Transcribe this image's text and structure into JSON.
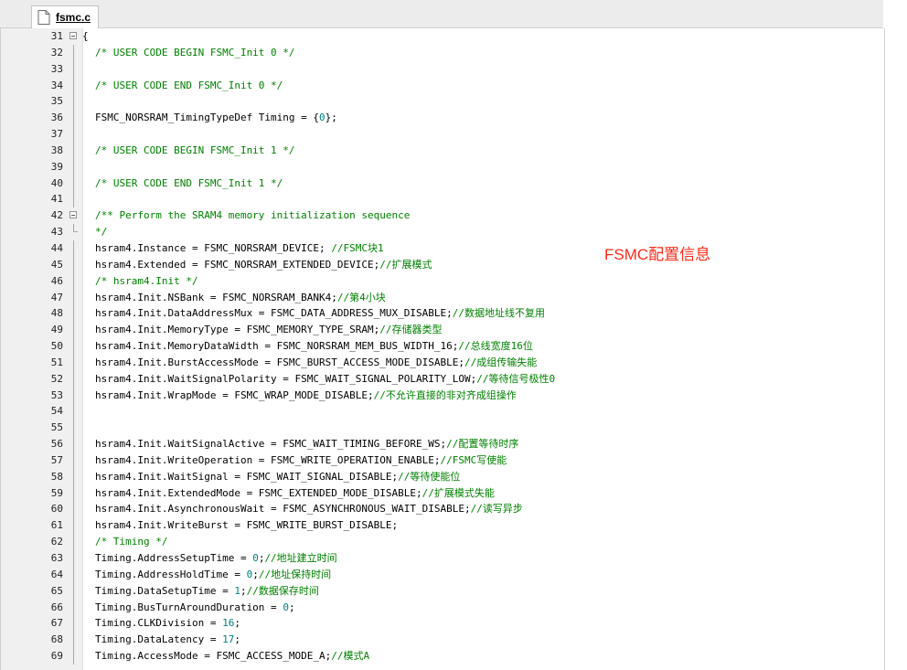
{
  "tab": {
    "label": "fsmc.c",
    "icon": "file-icon"
  },
  "annotation": "FSMC配置信息",
  "colors": {
    "comment": "#008000",
    "number": "#008080",
    "annotation": "#ff2a1a"
  },
  "code_lines": [
    {
      "n": "31",
      "fold": "open",
      "parts": [
        [
          "{",
          ""
        ]
      ]
    },
    {
      "n": "32",
      "fold": "line",
      "parts": [
        [
          "/* USER CODE BEGIN FSMC_Init 0 */",
          "cm"
        ]
      ]
    },
    {
      "n": "33",
      "fold": "line",
      "parts": []
    },
    {
      "n": "34",
      "fold": "line",
      "parts": [
        [
          "/* USER CODE END FSMC_Init 0 */",
          "cm"
        ]
      ]
    },
    {
      "n": "35",
      "fold": "line",
      "parts": []
    },
    {
      "n": "36",
      "fold": "line",
      "parts": [
        [
          "FSMC_NORSRAM_TimingTypeDef Timing = {",
          ""
        ],
        [
          "0",
          "num"
        ],
        [
          "};",
          ""
        ]
      ]
    },
    {
      "n": "37",
      "fold": "line",
      "parts": []
    },
    {
      "n": "38",
      "fold": "line",
      "parts": [
        [
          "/* USER CODE BEGIN FSMC_Init 1 */",
          "cm"
        ]
      ]
    },
    {
      "n": "39",
      "fold": "line",
      "parts": []
    },
    {
      "n": "40",
      "fold": "line",
      "parts": [
        [
          "/* USER CODE END FSMC_Init 1 */",
          "cm"
        ]
      ]
    },
    {
      "n": "41",
      "fold": "line",
      "parts": []
    },
    {
      "n": "42",
      "fold": "open",
      "parts": [
        [
          "/** Perform the SRAM4 memory initialization sequence",
          "cm"
        ]
      ]
    },
    {
      "n": "43",
      "fold": "end",
      "parts": [
        [
          "*/",
          "cm"
        ]
      ]
    },
    {
      "n": "44",
      "fold": "line",
      "parts": [
        [
          "hsram4.Instance = FSMC_NORSRAM_DEVICE; ",
          ""
        ],
        [
          "//FSMC块1",
          "cm"
        ]
      ]
    },
    {
      "n": "45",
      "fold": "line",
      "parts": [
        [
          "hsram4.Extended = FSMC_NORSRAM_EXTENDED_DEVICE;",
          ""
        ],
        [
          "//扩展模式",
          "cm"
        ]
      ]
    },
    {
      "n": "46",
      "fold": "line",
      "parts": [
        [
          "/* hsram4.Init */",
          "cm"
        ]
      ]
    },
    {
      "n": "47",
      "fold": "line",
      "parts": [
        [
          "hsram4.Init.NSBank = FSMC_NORSRAM_BANK4;",
          ""
        ],
        [
          "//第4小块",
          "cm"
        ]
      ]
    },
    {
      "n": "48",
      "fold": "line",
      "parts": [
        [
          "hsram4.Init.DataAddressMux = FSMC_DATA_ADDRESS_MUX_DISABLE;",
          ""
        ],
        [
          "//数据地址线不复用",
          "cm"
        ]
      ]
    },
    {
      "n": "49",
      "fold": "line",
      "parts": [
        [
          "hsram4.Init.MemoryType = FSMC_MEMORY_TYPE_SRAM;",
          ""
        ],
        [
          "//存储器类型",
          "cm"
        ]
      ]
    },
    {
      "n": "50",
      "fold": "line",
      "parts": [
        [
          "hsram4.Init.MemoryDataWidth = FSMC_NORSRAM_MEM_BUS_WIDTH_16;",
          ""
        ],
        [
          "//总线宽度16位",
          "cm"
        ]
      ]
    },
    {
      "n": "51",
      "fold": "line",
      "parts": [
        [
          "hsram4.Init.BurstAccessMode = FSMC_BURST_ACCESS_MODE_DISABLE;",
          ""
        ],
        [
          "//成组传输失能",
          "cm"
        ]
      ]
    },
    {
      "n": "52",
      "fold": "line",
      "parts": [
        [
          "hsram4.Init.WaitSignalPolarity = FSMC_WAIT_SIGNAL_POLARITY_LOW;",
          ""
        ],
        [
          "//等待信号极性0",
          "cm"
        ]
      ]
    },
    {
      "n": "53",
      "fold": "line",
      "parts": [
        [
          "hsram4.Init.WrapMode = FSMC_WRAP_MODE_DISABLE;",
          ""
        ],
        [
          "//不允许直接的非对齐成组操作",
          "cm"
        ]
      ]
    },
    {
      "n": "54",
      "fold": "line",
      "parts": []
    },
    {
      "n": "55",
      "fold": "line",
      "parts": []
    },
    {
      "n": "56",
      "fold": "line",
      "parts": [
        [
          "hsram4.Init.WaitSignalActive = FSMC_WAIT_TIMING_BEFORE_WS;",
          ""
        ],
        [
          "//配置等待时序",
          "cm"
        ]
      ]
    },
    {
      "n": "57",
      "fold": "line",
      "parts": [
        [
          "hsram4.Init.WriteOperation = FSMC_WRITE_OPERATION_ENABLE;",
          ""
        ],
        [
          "//FSMC写使能",
          "cm"
        ]
      ]
    },
    {
      "n": "58",
      "fold": "line",
      "parts": [
        [
          "hsram4.Init.WaitSignal = FSMC_WAIT_SIGNAL_DISABLE;",
          ""
        ],
        [
          "//等待使能位",
          "cm"
        ]
      ]
    },
    {
      "n": "59",
      "fold": "line",
      "parts": [
        [
          "hsram4.Init.ExtendedMode = FSMC_EXTENDED_MODE_DISABLE;",
          ""
        ],
        [
          "//扩展模式失能",
          "cm"
        ]
      ]
    },
    {
      "n": "60",
      "fold": "line",
      "parts": [
        [
          "hsram4.Init.AsynchronousWait = FSMC_ASYNCHRONOUS_WAIT_DISABLE;",
          ""
        ],
        [
          "//读写异步",
          "cm"
        ]
      ]
    },
    {
      "n": "61",
      "fold": "line",
      "parts": [
        [
          "hsram4.Init.WriteBurst = FSMC_WRITE_BURST_DISABLE;",
          ""
        ]
      ]
    },
    {
      "n": "62",
      "fold": "line",
      "parts": [
        [
          "/* Timing */",
          "cm"
        ]
      ]
    },
    {
      "n": "63",
      "fold": "line",
      "parts": [
        [
          "Timing.AddressSetupTime = ",
          ""
        ],
        [
          "0",
          "num"
        ],
        [
          ";",
          ""
        ],
        [
          "//地址建立时间",
          "cm"
        ]
      ]
    },
    {
      "n": "64",
      "fold": "line",
      "parts": [
        [
          "Timing.AddressHoldTime = ",
          ""
        ],
        [
          "0",
          "num"
        ],
        [
          ";",
          ""
        ],
        [
          "//地址保持时间",
          "cm"
        ]
      ]
    },
    {
      "n": "65",
      "fold": "line",
      "parts": [
        [
          "Timing.DataSetupTime = ",
          ""
        ],
        [
          "1",
          "num"
        ],
        [
          ";",
          ""
        ],
        [
          "//数据保存时间",
          "cm"
        ]
      ]
    },
    {
      "n": "66",
      "fold": "line",
      "parts": [
        [
          "Timing.BusTurnAroundDuration = ",
          ""
        ],
        [
          "0",
          "num"
        ],
        [
          ";",
          ""
        ]
      ]
    },
    {
      "n": "67",
      "fold": "line",
      "parts": [
        [
          "Timing.CLKDivision = ",
          ""
        ],
        [
          "16",
          "num"
        ],
        [
          ";",
          ""
        ]
      ]
    },
    {
      "n": "68",
      "fold": "line",
      "parts": [
        [
          "Timing.DataLatency = ",
          ""
        ],
        [
          "17",
          "num"
        ],
        [
          ";",
          ""
        ]
      ]
    },
    {
      "n": "69",
      "fold": "line",
      "parts": [
        [
          "Timing.AccessMode = FSMC_ACCESS_MODE_A;",
          ""
        ],
        [
          "//模式A",
          "cm"
        ]
      ]
    }
  ]
}
